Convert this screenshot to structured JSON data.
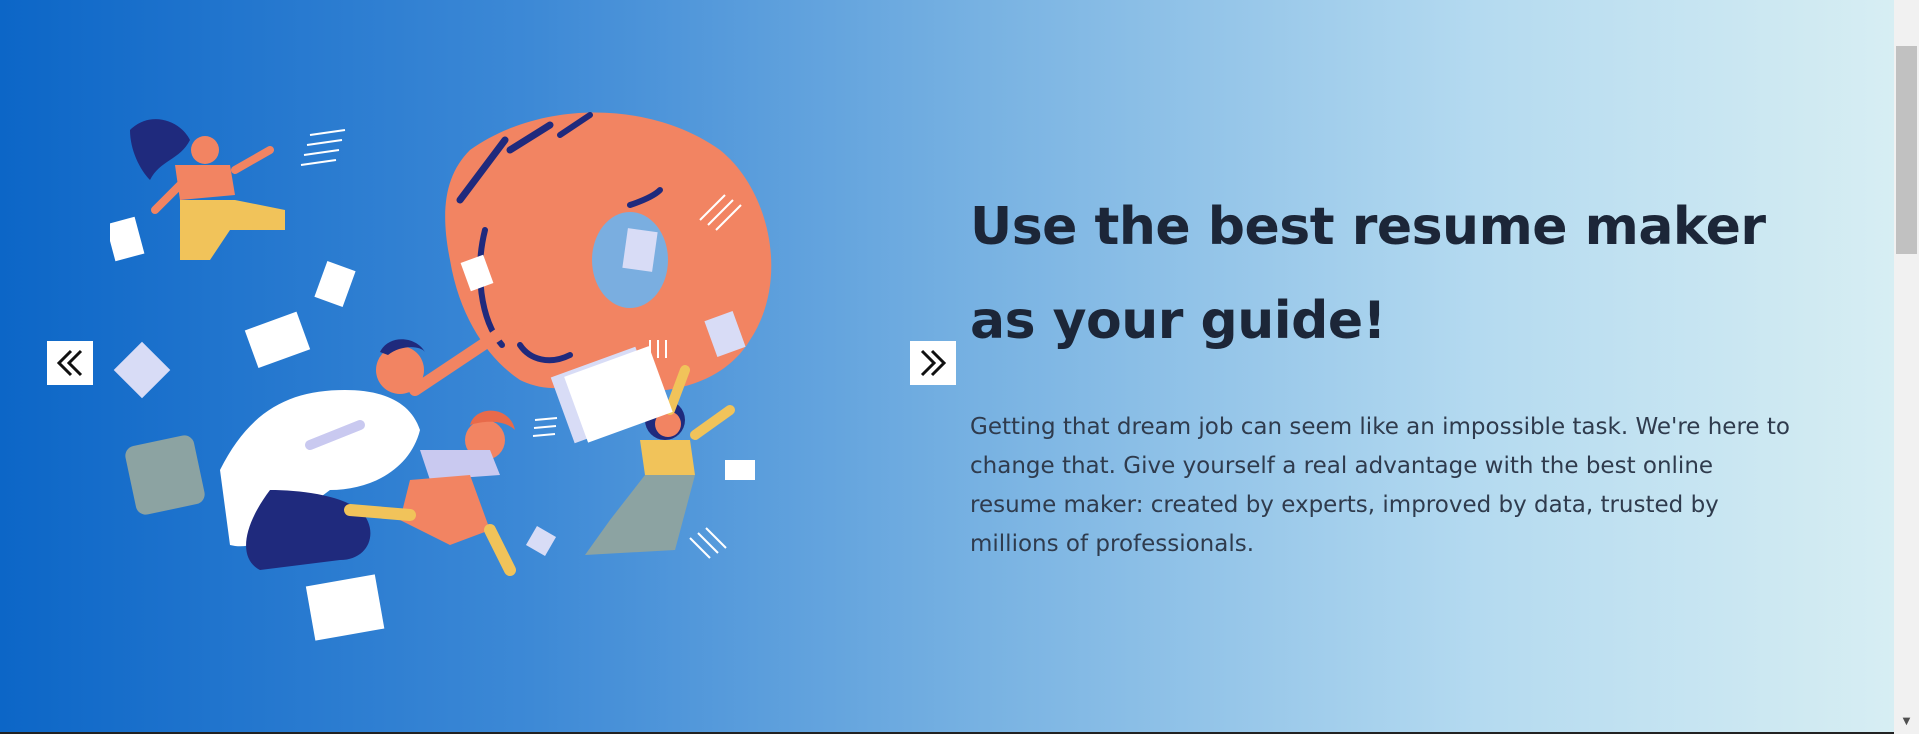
{
  "hero": {
    "headline": "Use the best resume maker as your guide!",
    "body": "Getting that dream job can seem like an impossible task. We're here to change that. Give yourself a real advantage with the best online resume maker: created by experts, improved by data, trusted by millions of professionals.",
    "illustration_icon": "people-reaching-for-hand-illustration"
  },
  "carousel": {
    "prev_icon": "double-chevron-left-icon",
    "next_icon": "double-chevron-right-icon"
  },
  "scrollbar": {
    "down_arrow": "▼"
  },
  "colors": {
    "gradient_start": "#0c66c7",
    "gradient_end": "#d7eef3",
    "headline": "#1c2638",
    "body_text": "#2f3b4d",
    "hand": "#f28462",
    "navy": "#1f2a7d",
    "yellow": "#f1c35a",
    "lavender": "#c9c9f0"
  }
}
